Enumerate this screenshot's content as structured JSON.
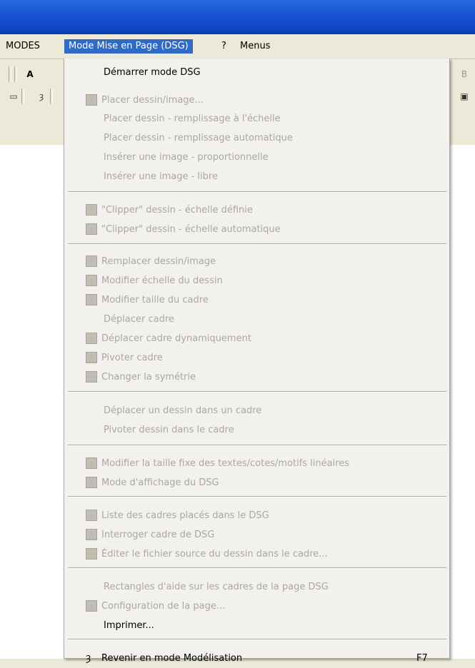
{
  "menubar": {
    "items": [
      "MODES",
      "Mode Mise en Page (DSG)",
      "?",
      "Menus"
    ],
    "active_index": 1
  },
  "toolbar": {
    "row1_text": "Ā",
    "right_glyph": "B"
  },
  "menu": {
    "items": [
      {
        "label": "Démarrer mode DSG",
        "enabled": true,
        "icon": null
      },
      {
        "label": "Placer dessin/image...",
        "enabled": false,
        "icon": "place-image-icon"
      },
      {
        "label": "Placer dessin - remplissage à l'échelle",
        "enabled": false,
        "icon": null
      },
      {
        "label": "Placer dessin - remplissage automatique",
        "enabled": false,
        "icon": null
      },
      {
        "label": "Insérer une image - proportionnelle",
        "enabled": false,
        "icon": null
      },
      {
        "label": "Insérer une image - libre",
        "enabled": false,
        "icon": null
      },
      {
        "label": "\"Clipper\" dessin - échelle définie",
        "enabled": false,
        "icon": "clip-scale-icon"
      },
      {
        "label": "\"Clipper\" dessin - échelle automatique",
        "enabled": false,
        "icon": "clip-auto-icon"
      },
      {
        "label": "Remplacer dessin/image",
        "enabled": false,
        "icon": "replace-image-icon"
      },
      {
        "label": "Modifier échelle du dessin",
        "enabled": false,
        "icon": "scale-drawing-icon"
      },
      {
        "label": "Modifier taille du cadre",
        "enabled": false,
        "icon": "frame-size-icon"
      },
      {
        "label": "Déplacer cadre",
        "enabled": false,
        "icon": null
      },
      {
        "label": "Déplacer cadre dynamiquement",
        "enabled": false,
        "icon": "move-dynamic-icon"
      },
      {
        "label": "Pivoter cadre",
        "enabled": false,
        "icon": "rotate-frame-icon"
      },
      {
        "label": "Changer la symétrie",
        "enabled": false,
        "icon": "symmetry-icon"
      },
      {
        "label": "Déplacer un dessin dans un cadre",
        "enabled": false,
        "icon": null
      },
      {
        "label": "Pivoter dessin dans le cadre",
        "enabled": false,
        "icon": null
      },
      {
        "label": "Modifier la taille fixe des textes/cotes/motifs linéaires",
        "enabled": false,
        "icon": "text-size-icon"
      },
      {
        "label": "Mode d'affichage du DSG",
        "enabled": false,
        "icon": "display-mode-icon"
      },
      {
        "label": "Liste des cadres placés dans le DSG",
        "enabled": false,
        "icon": "frame-list-icon"
      },
      {
        "label": "Interroger cadre de DSG",
        "enabled": false,
        "icon": "query-frame-icon"
      },
      {
        "label": "Éditer le fichier source du dessin dans le cadre...",
        "enabled": false,
        "icon": "edit-source-icon"
      },
      {
        "label": "Rectangles d'aide sur les cadres de la page DSG",
        "enabled": false,
        "icon": null
      },
      {
        "label": "Configuration de la page...",
        "enabled": false,
        "icon": "page-config-icon"
      },
      {
        "label": "Imprimer...",
        "enabled": true,
        "icon": null
      },
      {
        "label": "Revenir en mode Modélisation",
        "enabled": true,
        "icon": "return-modeling-icon",
        "shortcut": "F7"
      }
    ]
  }
}
